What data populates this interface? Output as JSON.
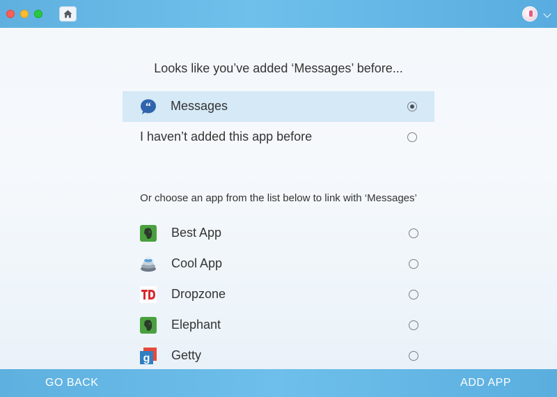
{
  "header": {
    "home_icon": "home-icon",
    "account_icon": "avatar",
    "menu_icon": "chevron-down-icon"
  },
  "main": {
    "heading": "Looks like you’ve added ‘Messages’ before...",
    "options": [
      {
        "label": "Messages",
        "icon": "messages-icon",
        "selected": true
      },
      {
        "label": "I haven’t added this app before",
        "selected": false
      }
    ],
    "subheading": "Or choose an app from the list below to link with ‘Messages’",
    "apps": [
      {
        "label": "Best App",
        "icon": "evernote-icon",
        "selected": false
      },
      {
        "label": "Cool App",
        "icon": "stack-icon",
        "selected": false
      },
      {
        "label": "Dropzone",
        "icon": "td-icon",
        "selected": false
      },
      {
        "label": "Elephant",
        "icon": "evernote-icon",
        "selected": false
      },
      {
        "label": "Getty",
        "icon": "getty-icon",
        "selected": false
      }
    ]
  },
  "footer": {
    "back_label": "GO BACK",
    "add_label": "ADD APP"
  },
  "colors": {
    "accent": "#5fb0df",
    "selected_row": "#d5e9f6"
  }
}
